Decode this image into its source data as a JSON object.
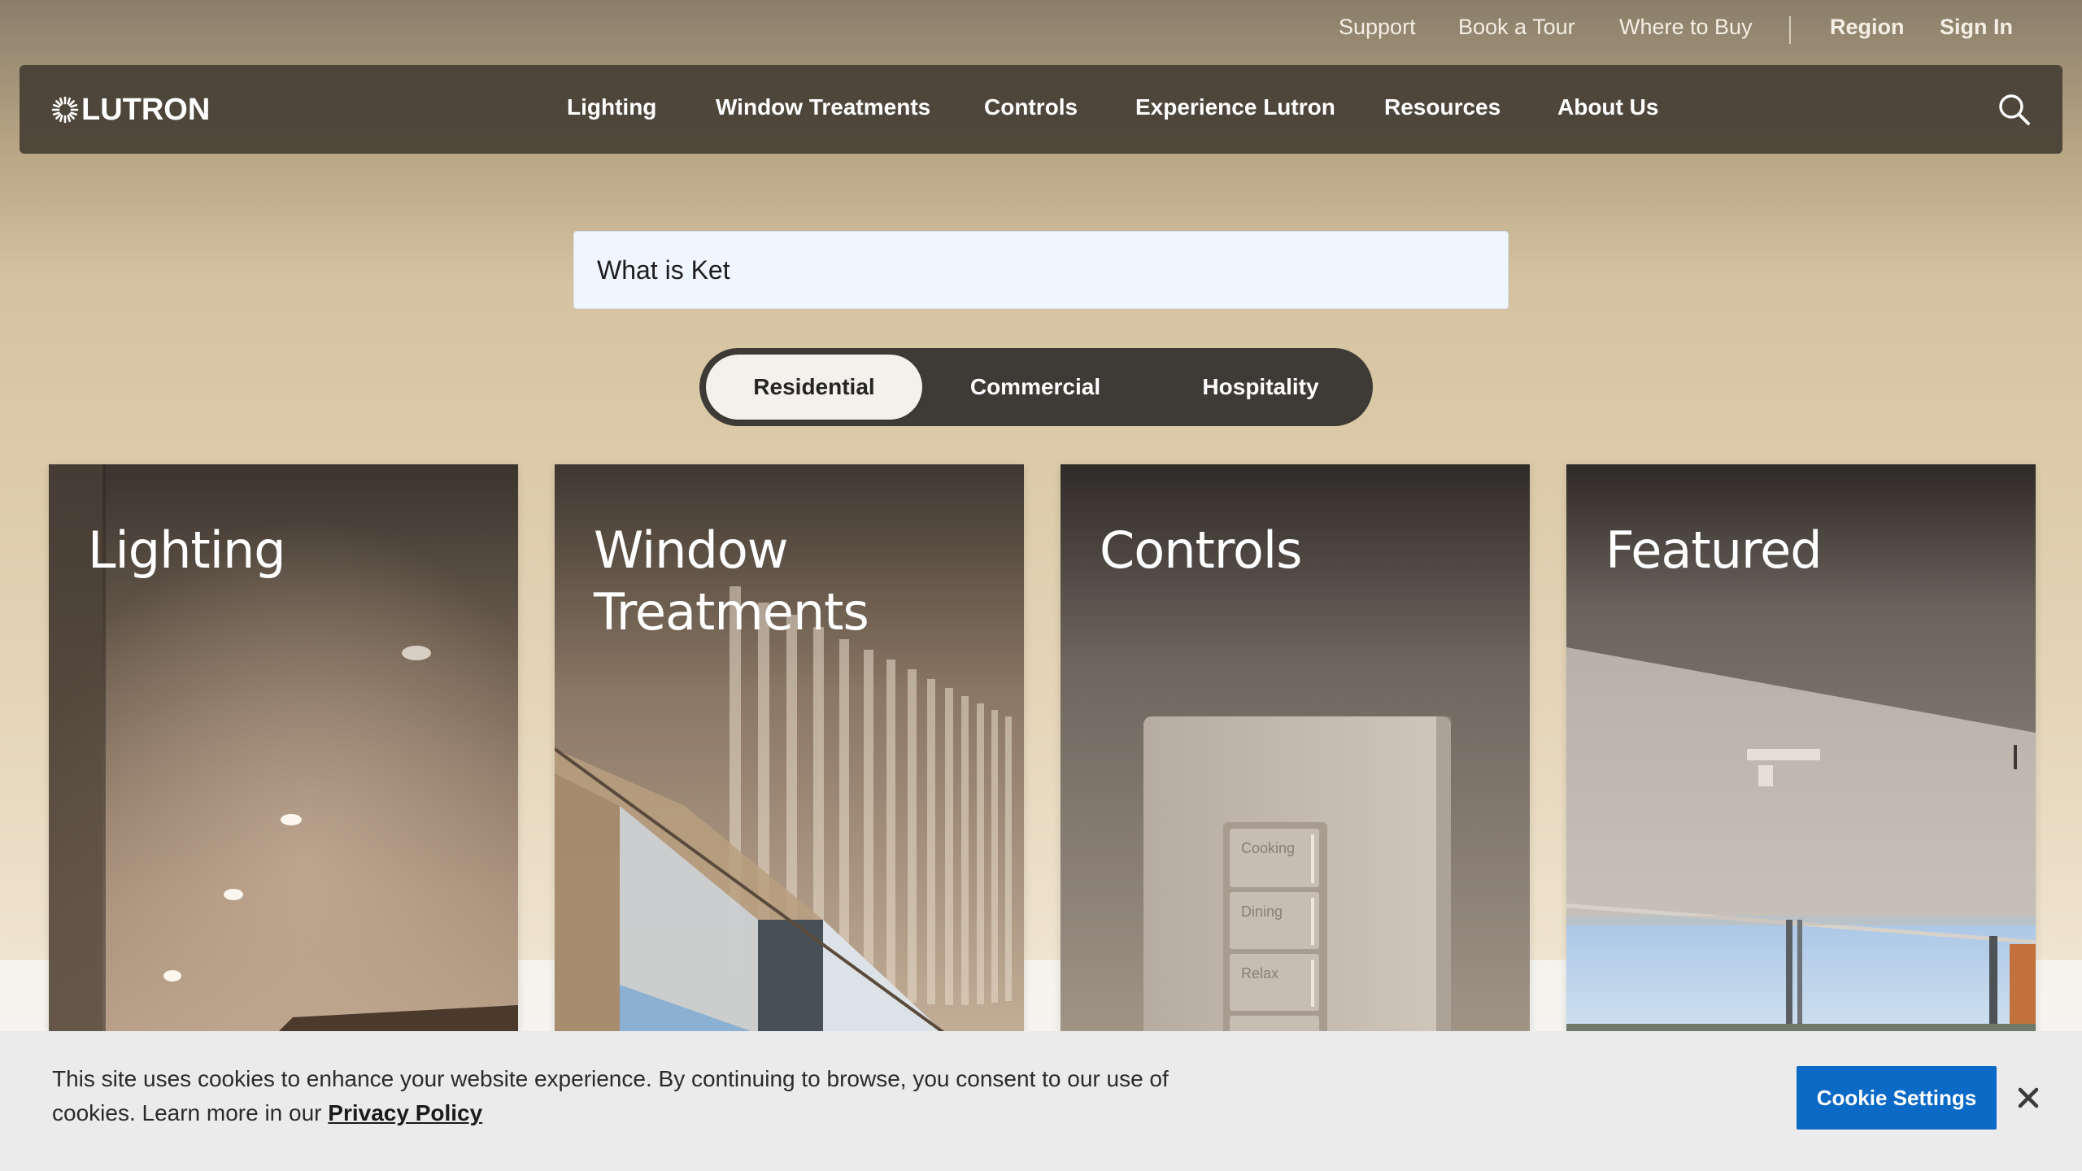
{
  "utility": {
    "support": "Support",
    "book_tour": "Book a Tour",
    "where_to_buy": "Where to Buy",
    "region": "Region",
    "sign_in": "Sign In"
  },
  "brand": {
    "logo_text": "LUTRON"
  },
  "nav": {
    "items": [
      "Lighting",
      "Window Treatments",
      "Controls",
      "Experience Lutron",
      "Resources",
      "About Us"
    ],
    "search_icon": "search-icon"
  },
  "search": {
    "value": "What is Ket"
  },
  "segments": {
    "items": [
      "Residential",
      "Commercial",
      "Hospitality"
    ],
    "active": "Residential"
  },
  "cards": [
    {
      "title": "Lighting"
    },
    {
      "title": "Window Treatments"
    },
    {
      "title": "Controls",
      "keypad_buttons": [
        "Cooking",
        "Dining",
        "Relax"
      ]
    },
    {
      "title": "Featured"
    }
  ],
  "cookie": {
    "message": "This site uses cookies to enhance your website experience. By continuing to browse, you consent to our use of cookies. Learn more in our",
    "link": "Privacy Policy",
    "settings_button": "Cookie Settings",
    "close_icon": "close-icon"
  },
  "colors": {
    "nav_bg": "#484036",
    "accent_blue": "#0b6ac6",
    "segment_bg": "#3e3a35",
    "search_bg": "#eff6ff"
  }
}
